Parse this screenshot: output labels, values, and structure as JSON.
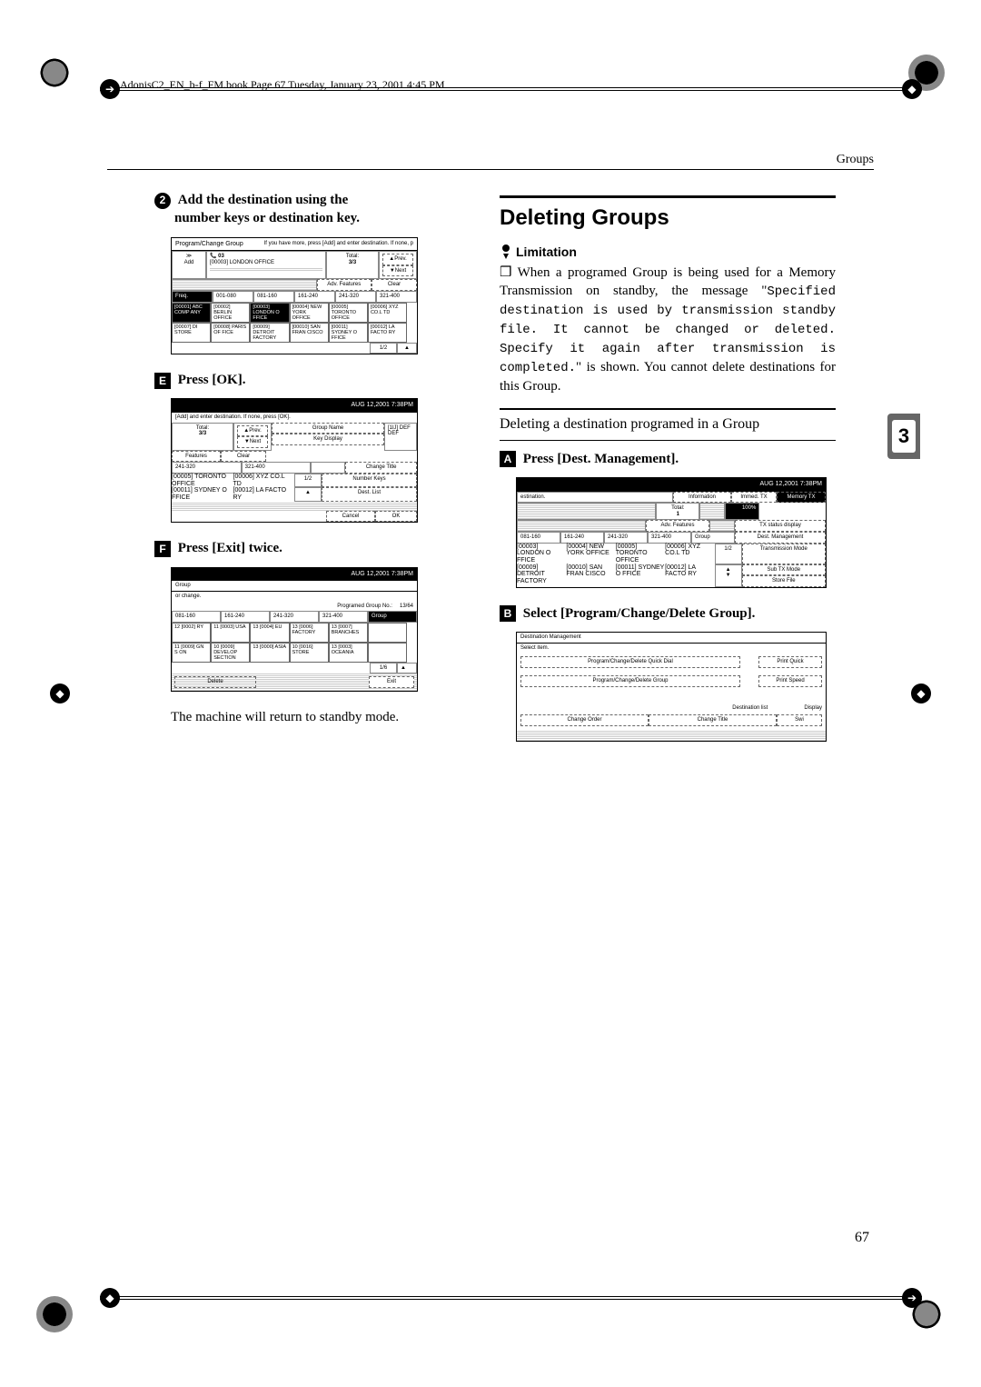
{
  "header": {
    "book_info": "AdonisC2_EN_b-f_FM.book  Page 67  Tuesday, January 23, 2001  4:45 PM"
  },
  "section_label": "Groups",
  "left": {
    "step2": {
      "bullet": "2",
      "text_a": "Add the destination using the",
      "text_b": "number keys or destination key."
    },
    "screenA": {
      "title": "Program/Change Group",
      "hint": "If you have more, press [Add] and enter destination. If none, p",
      "add": "Add",
      "group_no": "03",
      "group_line": "[00003] LONDON OFFICE",
      "total_label": "Total:",
      "total_val": "3/3",
      "prev": "▲Prev.",
      "next": "▼Next",
      "adv_features": "Adv. Features",
      "clear": "Clear",
      "tabs": [
        "Freq.",
        "001-080",
        "081-160",
        "161-240",
        "241-320",
        "321-400"
      ],
      "cells": [
        "[00001] ABC COMP ANY",
        "[00002] BERLIN OFFICE",
        "[00003] LONDON O FFICE",
        "[00004] NEW YORK OFFICE",
        "[00005] TORONTO OFFICE",
        "[00006] XYZ CO.L TD",
        "[00007] DI STORE",
        "[00008] PARIS OF FICE",
        "[00009] DETROIT FACTORY",
        "[00010] SAN FRAN CISCO",
        "[00011] SYDNEY O FFICE",
        "[00012] LA FACTO RY"
      ],
      "pager": "1/2"
    },
    "step5": {
      "text": "Press [OK]."
    },
    "screenB": {
      "timestamp": "AUG  12,2001  7:38PM",
      "hint": "[Add] and enter destination. If none, press [OK].",
      "total_label": "Total:",
      "total_val": "3/3",
      "prev": "▲Prev.",
      "next": "▼Next",
      "group_name": "Group Name",
      "key_display": "Key Display",
      "change_title": "Change Title",
      "number_keys": "Number Keys",
      "dest_list": "Dest. List",
      "abc": "[1Ĳ] DEF",
      "def": "DEF",
      "features": "Features",
      "clear": "Clear",
      "tabs": [
        "241-320",
        "321-400"
      ],
      "cells": [
        "[00005] TORONTO OFFICE",
        "[00006] XYZ CO.L TD",
        "[00011] SYDNEY O FFICE",
        "[00012] LA FACTO RY"
      ],
      "pager": "1/2",
      "cancel": "Cancel",
      "ok": "OK"
    },
    "step6": {
      "text": "Press [Exit] twice."
    },
    "screenC": {
      "timestamp": "AUG  12,2001  7:38PM",
      "title": "Group",
      "hint": "or change.",
      "prog_label": "Programed Group No.:",
      "prog_val": "13/64",
      "tabs": [
        "081-160",
        "161-240",
        "241-320",
        "321-400",
        "Group"
      ],
      "cells": [
        "12 [0002] RY",
        "11 [0003] USA",
        "13 [0004] EU",
        "13 [0006] FACTORY",
        "13 [0007] BRANCHES",
        "",
        "11 [0009] GN S ON",
        "10 [0009] DEVELOP SECTION",
        "13 [0000] ASIA",
        "10 [0016] STORE",
        "13 [0003] OCEANIA",
        ""
      ],
      "pager": "1/6",
      "delete": "Delete",
      "exit": "Exit"
    },
    "return_text": "The machine will return to standby mode."
  },
  "right": {
    "title": "Deleting Groups",
    "limitation_label": "Limitation",
    "limitation_text_a": "When a programed Group is being used for a Memory Transmission on standby, the message \"",
    "limitation_mono": "Specified destination is used by transmission standby file. It cannot be changed or deleted. Specify it again after transmission is completed.",
    "limitation_text_b": "\" is shown. You cannot delete destinations for this Group.",
    "sub_heading": "Deleting a destination programed in a Group",
    "stepA": {
      "text": "Press [Dest. Management]."
    },
    "screenD": {
      "timestamp": "AUG  12,2001  7:38PM",
      "estimation": "estination.",
      "information": "Information",
      "immed": "Immed. TX",
      "memory": "Memory TX",
      "total_label": "Total:",
      "total_val": "1",
      "pct": "100%",
      "adv_features": "Adv. Features",
      "tx_status": "TX status display",
      "tabs": [
        "081-160",
        "161-240",
        "241-320",
        "321-400",
        "Group"
      ],
      "dest_mgmt": "Dest. Management",
      "trans_mode": "Transmission Mode",
      "sub_tx": "Sub TX Mode",
      "store_file": "Store File",
      "cells": [
        "[00003] LONDON O FFICE",
        "[00004] NEW YORK OFFICE",
        "[00005] TORONTO OFFICE",
        "[00006] XYZ CO.L TD",
        "[00009] DETROIT FACTORY",
        "[00010] SAN FRAN CISCO",
        "[00011] SYDNEY O FFICE",
        "[00012] LA FACTO RY"
      ],
      "pager": "1/2"
    },
    "stepB": {
      "text": "Select [Program/Change/Delete Group]."
    },
    "screenE": {
      "title": "Destination Management",
      "select": "Select item.",
      "opt1": "Program/Change/Delete Quick Dial",
      "opt2": "Program/Change/Delete Group",
      "print_quick": "Print Quick",
      "print_speed": "Print Speed",
      "dest_list": "Destination list",
      "change_order": "Change Order",
      "change_title": "Change Title",
      "display": "Display",
      "swi": "Swi"
    }
  },
  "footer": {
    "page": "67",
    "tab": "3"
  }
}
